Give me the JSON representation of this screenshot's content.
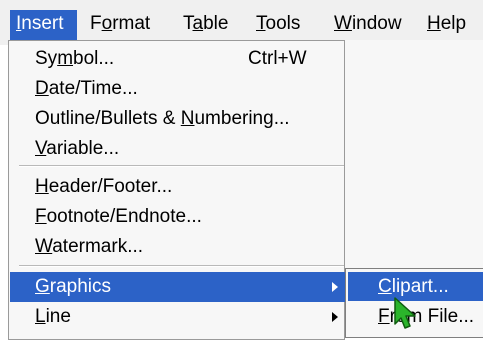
{
  "menubar": {
    "items": [
      {
        "pre": "",
        "u": "I",
        "post": "nsert"
      },
      {
        "pre": "F",
        "u": "o",
        "post": "rmat"
      },
      {
        "pre": "T",
        "u": "a",
        "post": "ble"
      },
      {
        "pre": "",
        "u": "T",
        "post": "ools"
      },
      {
        "pre": "",
        "u": "W",
        "post": "indow"
      },
      {
        "pre": "",
        "u": "H",
        "post": "elp"
      }
    ]
  },
  "insert_menu": {
    "items": [
      {
        "pre": "Sy",
        "u": "m",
        "post": "bol...",
        "shortcut": "Ctrl+W"
      },
      {
        "pre": "",
        "u": "D",
        "post": "ate/Time..."
      },
      {
        "pre": "Outline/Bullets & ",
        "u": "N",
        "post": "umbering..."
      },
      {
        "pre": "",
        "u": "V",
        "post": "ariable..."
      },
      {
        "pre": "",
        "u": "H",
        "post": "eader/Footer..."
      },
      {
        "pre": "",
        "u": "F",
        "post": "ootnote/Endnote..."
      },
      {
        "pre": "",
        "u": "W",
        "post": "atermark..."
      },
      {
        "pre": "",
        "u": "G",
        "post": "raphics"
      },
      {
        "pre": "",
        "u": "L",
        "post": "ine"
      }
    ]
  },
  "graphics_submenu": {
    "items": [
      {
        "pre": "",
        "u": "C",
        "post": "lipart..."
      },
      {
        "pre": "",
        "u": "F",
        "post": "rom File..."
      }
    ]
  },
  "colors": {
    "highlight": "#2c62c7",
    "menu_bg": "#f7f7f7",
    "menubar_bg": "#f0f0f0",
    "cursor": "#2bb52b"
  }
}
